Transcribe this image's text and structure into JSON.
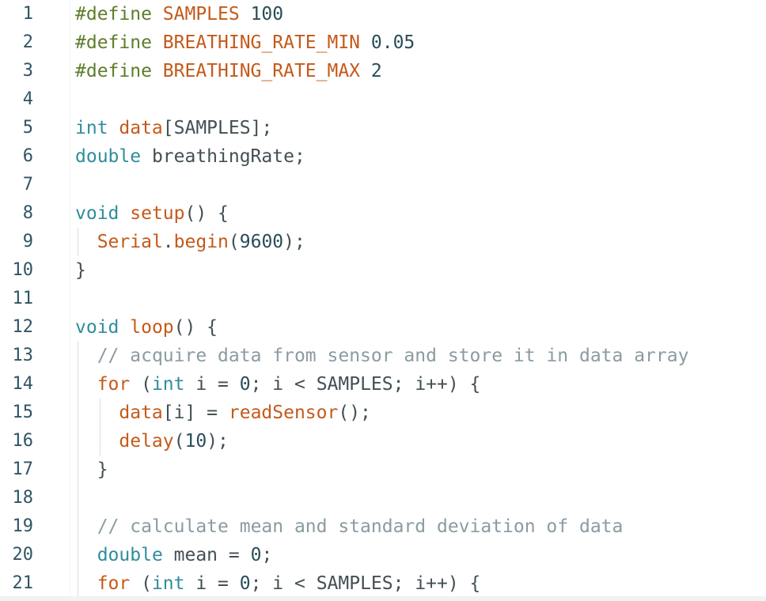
{
  "lines": [
    {
      "n": "1",
      "tokens": [
        {
          "c": "tok-pre",
          "t": "#define "
        },
        {
          "c": "tok-macro",
          "t": "SAMPLES"
        },
        {
          "c": "tok-num",
          "t": " 100"
        }
      ]
    },
    {
      "n": "2",
      "tokens": [
        {
          "c": "tok-pre",
          "t": "#define "
        },
        {
          "c": "tok-macro",
          "t": "BREATHING_RATE_MIN"
        },
        {
          "c": "tok-num",
          "t": " 0.05"
        }
      ]
    },
    {
      "n": "3",
      "tokens": [
        {
          "c": "tok-pre",
          "t": "#define "
        },
        {
          "c": "tok-macro",
          "t": "BREATHING_RATE_MAX"
        },
        {
          "c": "tok-num",
          "t": " 2"
        }
      ]
    },
    {
      "n": "4",
      "tokens": []
    },
    {
      "n": "5",
      "tokens": [
        {
          "c": "tok-type",
          "t": "int "
        },
        {
          "c": "tok-fn",
          "t": "data"
        },
        {
          "c": "tok-plain",
          "t": "[SAMPLES];"
        }
      ]
    },
    {
      "n": "6",
      "tokens": [
        {
          "c": "tok-type",
          "t": "double "
        },
        {
          "c": "tok-plain",
          "t": "breathingRate;"
        }
      ]
    },
    {
      "n": "7",
      "tokens": []
    },
    {
      "n": "8",
      "tokens": [
        {
          "c": "tok-type",
          "t": "void "
        },
        {
          "c": "tok-fn",
          "t": "setup"
        },
        {
          "c": "tok-plain",
          "t": "() {"
        }
      ]
    },
    {
      "n": "9",
      "tokens": [
        {
          "c": "tok-plain",
          "t": "  "
        },
        {
          "c": "tok-fn",
          "t": "Serial"
        },
        {
          "c": "tok-plain",
          "t": "."
        },
        {
          "c": "tok-fn",
          "t": "begin"
        },
        {
          "c": "tok-plain",
          "t": "("
        },
        {
          "c": "tok-num",
          "t": "9600"
        },
        {
          "c": "tok-plain",
          "t": ");"
        }
      ]
    },
    {
      "n": "10",
      "tokens": [
        {
          "c": "tok-plain",
          "t": "}"
        }
      ]
    },
    {
      "n": "11",
      "tokens": []
    },
    {
      "n": "12",
      "tokens": [
        {
          "c": "tok-type",
          "t": "void "
        },
        {
          "c": "tok-fn",
          "t": "loop"
        },
        {
          "c": "tok-plain",
          "t": "() {"
        }
      ]
    },
    {
      "n": "13",
      "tokens": [
        {
          "c": "tok-plain",
          "t": "  "
        },
        {
          "c": "tok-cmt",
          "t": "// acquire data from sensor and store it in data array"
        }
      ]
    },
    {
      "n": "14",
      "tokens": [
        {
          "c": "tok-plain",
          "t": "  "
        },
        {
          "c": "tok-fn",
          "t": "for"
        },
        {
          "c": "tok-plain",
          "t": " ("
        },
        {
          "c": "tok-type",
          "t": "int"
        },
        {
          "c": "tok-plain",
          "t": " i = "
        },
        {
          "c": "tok-num",
          "t": "0"
        },
        {
          "c": "tok-plain",
          "t": "; i < SAMPLES; i++) {"
        }
      ]
    },
    {
      "n": "15",
      "tokens": [
        {
          "c": "tok-plain",
          "t": "    "
        },
        {
          "c": "tok-fn",
          "t": "data"
        },
        {
          "c": "tok-plain",
          "t": "[i] = "
        },
        {
          "c": "tok-fn",
          "t": "readSensor"
        },
        {
          "c": "tok-plain",
          "t": "();"
        }
      ]
    },
    {
      "n": "16",
      "tokens": [
        {
          "c": "tok-plain",
          "t": "    "
        },
        {
          "c": "tok-fn",
          "t": "delay"
        },
        {
          "c": "tok-plain",
          "t": "("
        },
        {
          "c": "tok-num",
          "t": "10"
        },
        {
          "c": "tok-plain",
          "t": ");"
        }
      ]
    },
    {
      "n": "17",
      "tokens": [
        {
          "c": "tok-plain",
          "t": "  }"
        }
      ]
    },
    {
      "n": "18",
      "tokens": []
    },
    {
      "n": "19",
      "tokens": [
        {
          "c": "tok-plain",
          "t": "  "
        },
        {
          "c": "tok-cmt",
          "t": "// calculate mean and standard deviation of data"
        }
      ]
    },
    {
      "n": "20",
      "tokens": [
        {
          "c": "tok-plain",
          "t": "  "
        },
        {
          "c": "tok-type",
          "t": "double"
        },
        {
          "c": "tok-plain",
          "t": " mean = "
        },
        {
          "c": "tok-num",
          "t": "0"
        },
        {
          "c": "tok-plain",
          "t": ";"
        }
      ]
    },
    {
      "n": "21",
      "tokens": [
        {
          "c": "tok-plain",
          "t": "  "
        },
        {
          "c": "tok-fn",
          "t": "for"
        },
        {
          "c": "tok-plain",
          "t": " ("
        },
        {
          "c": "tok-type",
          "t": "int"
        },
        {
          "c": "tok-plain",
          "t": " i = "
        },
        {
          "c": "tok-num",
          "t": "0"
        },
        {
          "c": "tok-plain",
          "t": "; i < SAMPLES; i++) {"
        }
      ]
    }
  ]
}
